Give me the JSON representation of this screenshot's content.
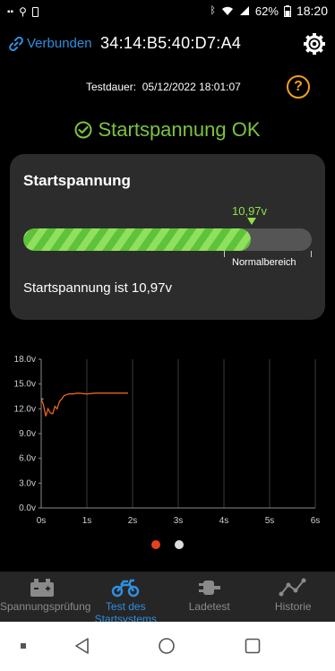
{
  "status_bar": {
    "battery": "62%",
    "time": "18:20"
  },
  "header": {
    "connection_label": "Verbunden",
    "device_id": "34:14:B5:40:D7:A4"
  },
  "test": {
    "duration_label": "Testdauer:",
    "date_time": "05/12/2022 18:01:07",
    "status_text": "Startspannung OK"
  },
  "card": {
    "title": "Startspannung",
    "value_label": "10,97v",
    "range_label": "Normalbereich",
    "summary": "Startspannung ist 10,97v",
    "fill_fraction": 0.79
  },
  "chart_data": {
    "type": "line",
    "y_ticks": [
      "18.0v",
      "15.0v",
      "12.0v",
      "9.0v",
      "6.0v",
      "3.0v",
      "0.0v"
    ],
    "x_ticks": [
      "0s",
      "1s",
      "2s",
      "3s",
      "4s",
      "5s",
      "6s"
    ],
    "ylim": [
      0,
      18
    ],
    "xlim": [
      0,
      6
    ],
    "grid": "vertical",
    "series": [
      {
        "color": "#e8641e",
        "x": [
          0,
          0.05,
          0.1,
          0.15,
          0.2,
          0.25,
          0.3,
          0.35,
          0.4,
          0.45,
          0.5,
          0.55,
          0.6,
          0.7,
          0.8,
          1.0,
          1.2,
          1.5,
          1.8,
          1.9
        ],
        "y": [
          13.2,
          12.5,
          11.1,
          12.0,
          11.5,
          11.4,
          12.3,
          12.0,
          12.9,
          13.2,
          13.6,
          13.7,
          13.8,
          13.8,
          13.9,
          13.8,
          13.9,
          13.9,
          13.9,
          13.9
        ]
      },
      {
        "color": "#a0a0a0",
        "x": [
          0,
          0.05
        ],
        "y": [
          13.2,
          13.2
        ]
      }
    ]
  },
  "pager": {
    "active_color": "#e8401e",
    "inactive_color": "#dddddd"
  },
  "nav": [
    {
      "label": "Spannungsprüfung",
      "icon": "battery-icon"
    },
    {
      "label": "Test des Startsystems",
      "icon": "motorcycle-icon"
    },
    {
      "label": "Ladetest",
      "icon": "plug-icon"
    },
    {
      "label": "Historie",
      "icon": "history-chart-icon"
    }
  ],
  "colors": {
    "accent": "#2f8fe0",
    "ok": "#7cc242",
    "warning": "#f0a020"
  }
}
